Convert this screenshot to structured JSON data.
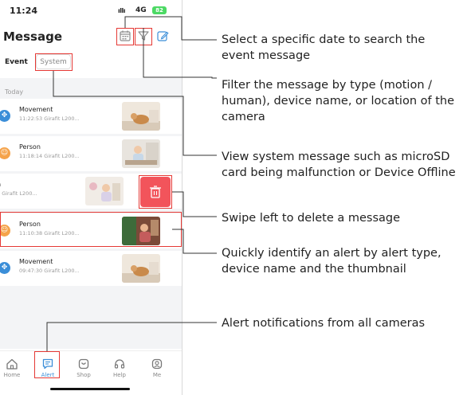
{
  "status": {
    "time": "11:24",
    "signal": "ıllı",
    "network": "4G",
    "battery": "82"
  },
  "header": {
    "title": "Message",
    "icons": [
      "calendar-icon",
      "filter-icon",
      "edit-icon"
    ]
  },
  "tabs": [
    {
      "label": "Event",
      "active": true
    },
    {
      "label": "System",
      "active": false
    }
  ],
  "section_label": "Today",
  "messages": [
    {
      "type": "Movement",
      "time": "11:22:53",
      "device": "Girafit L200...",
      "icon": "move-icon",
      "color": "#3b8ed8"
    },
    {
      "type": "Person",
      "time": "11:18:14",
      "device": "Girafit L200...",
      "icon": "person-icon",
      "color": "#f5a34a"
    },
    {
      "type": "n",
      "time": "5",
      "device": "Girafit L200...",
      "icon": "",
      "color": "#f5a34a"
    },
    {
      "type": "Person",
      "time": "11:10:38",
      "device": "Girafit L200...",
      "icon": "person-icon",
      "color": "#f5a34a"
    },
    {
      "type": "Movement",
      "time": "09:47:30",
      "device": "Girafit L200...",
      "icon": "move-icon",
      "color": "#3b8ed8"
    }
  ],
  "nav": [
    {
      "label": "Home",
      "icon": "home-icon"
    },
    {
      "label": "Alert",
      "icon": "alert-icon",
      "active": true
    },
    {
      "label": "Shop",
      "icon": "shop-icon"
    },
    {
      "label": "Help",
      "icon": "help-icon"
    },
    {
      "label": "Me",
      "icon": "me-icon"
    }
  ],
  "annotations": {
    "date": "Select a specific date to search the event message",
    "filter": "Filter the message by type (motion / human), device name, or location of the camera",
    "system": "View system message such as microSD card being malfunction or Device Offline",
    "delete": "Swipe left to delete a message",
    "identify": "Quickly identify an alert by alert type, device name and the thumbnail",
    "alerts": "Alert notifications from all cameras"
  },
  "colors": {
    "accent": "#e53935",
    "delete": "#f2545b",
    "movement": "#3b8ed8",
    "person": "#f5a34a"
  }
}
